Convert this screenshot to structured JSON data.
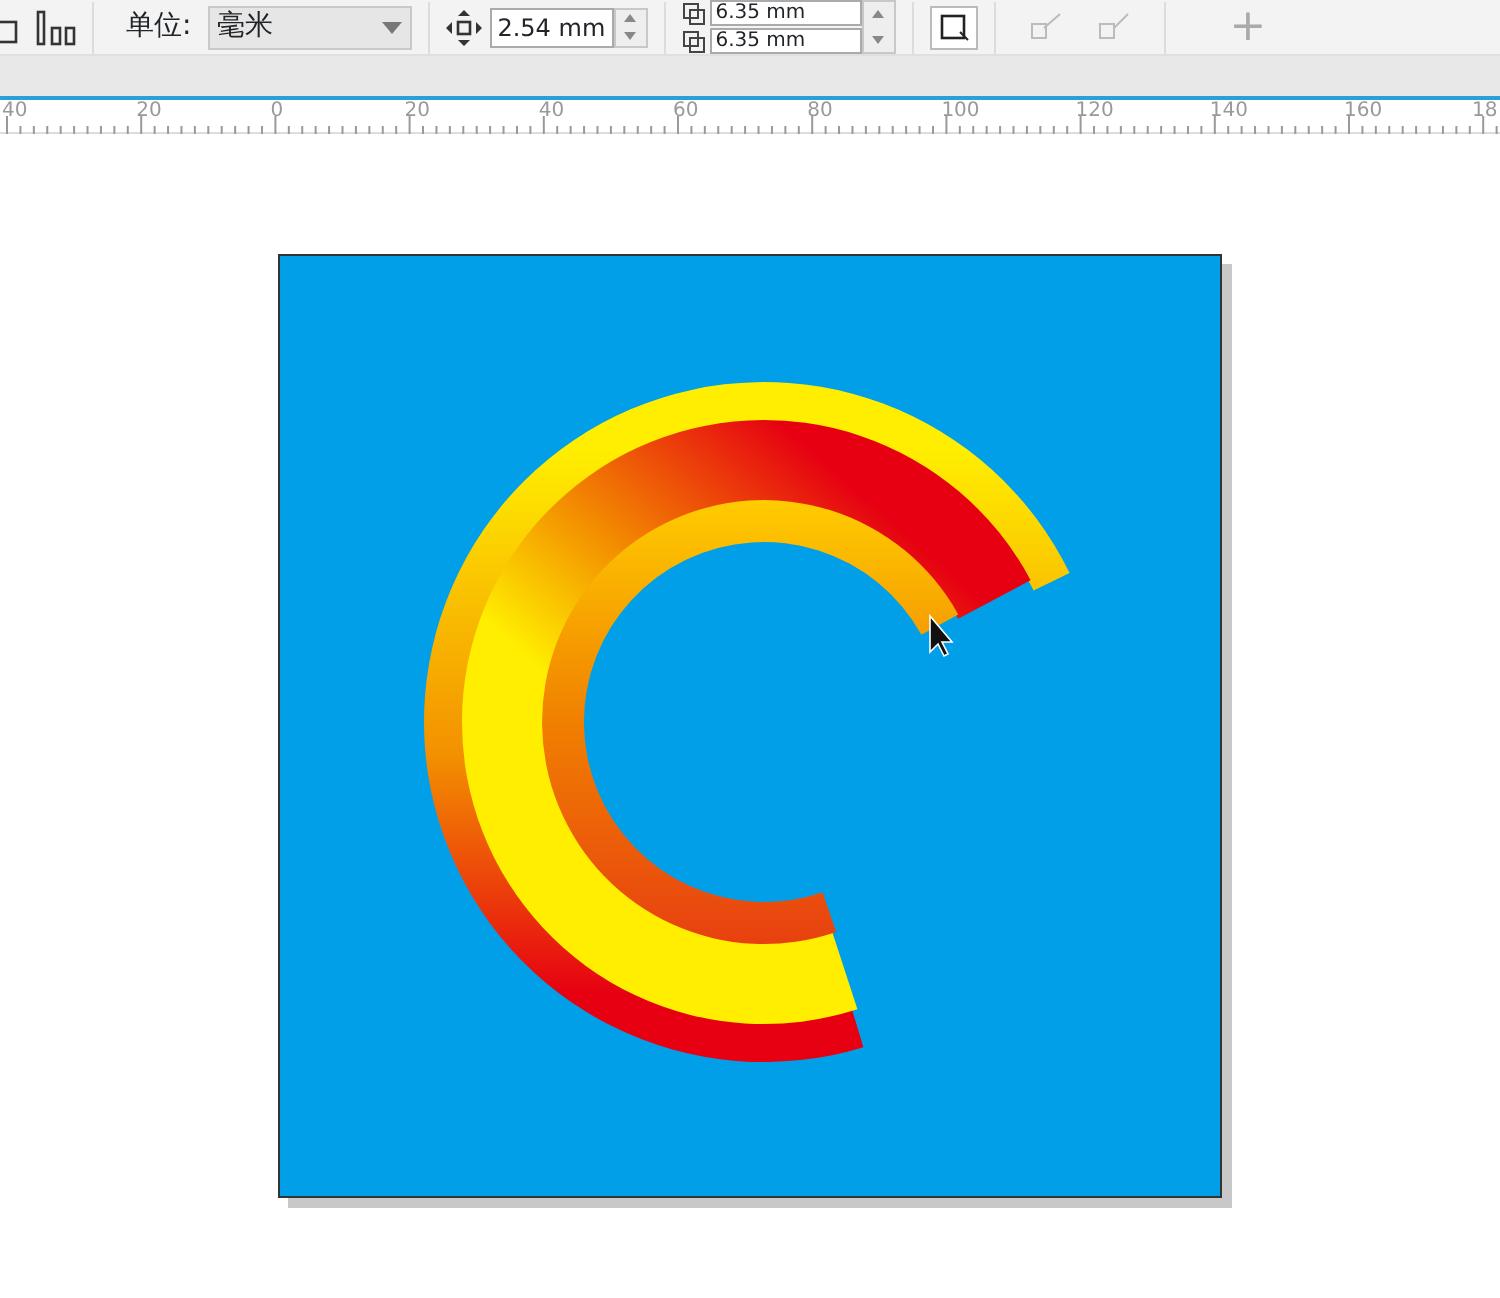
{
  "toolbar": {
    "unit_label": "单位:",
    "unit_value": "毫米",
    "nudge_value": "2.54 mm",
    "duplicate_x": "6.35 mm",
    "duplicate_y": "6.35 mm",
    "plus_symbol": "+"
  },
  "ruler": {
    "labels": [
      "40",
      "20",
      "0",
      "20",
      "40",
      "60",
      "80",
      "100",
      "120",
      "140",
      "160",
      "18"
    ]
  }
}
